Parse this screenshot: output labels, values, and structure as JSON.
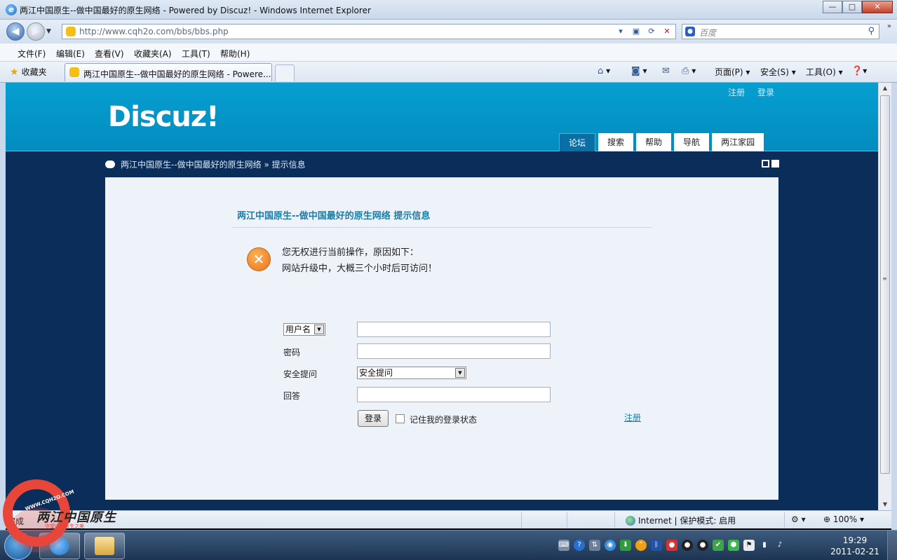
{
  "window": {
    "title": "两江中国原生--做中国最好的原生网络 - Powered by Discuz! - Windows Internet Explorer",
    "controls": {
      "minimize": "—",
      "maximize": "□",
      "close": "✕"
    }
  },
  "address_bar": {
    "url": "http://www.cqh2o.com/bbs/bbs.php",
    "search_placeholder": "百度"
  },
  "menu": [
    "文件(F)",
    "编辑(E)",
    "查看(V)",
    "收藏夹(A)",
    "工具(T)",
    "帮助(H)"
  ],
  "tabs_bar": {
    "favorites": "收藏夹",
    "active_tab": "两江中国原生--做中国最好的原生网络 - Powere...",
    "commands": {
      "page": "页面(P) ▾",
      "safety": "安全(S) ▾",
      "tools": "工具(O) ▾"
    }
  },
  "site": {
    "toplinks": [
      "注册",
      "登录"
    ],
    "logo": "Discuz!",
    "nav": [
      "论坛",
      "搜索",
      "帮助",
      "导航",
      "两江家园"
    ],
    "active_nav": 0,
    "breadcrumb": {
      "home": "两江中国原生--做中国最好的原生网络",
      "sep": "»",
      "current": "提示信息"
    }
  },
  "notice": {
    "heading": "两江中国原生--做中国最好的原生网络  提示信息",
    "line1": "您无权进行当前操作，原因如下：",
    "line2": "网站升级中，大概三个小时后可访问！"
  },
  "login_form": {
    "username_select": "用户名",
    "password_label": "密码",
    "question_label": "安全提问",
    "question_select": "安全提问",
    "answer_label": "回答",
    "submit": "登录",
    "remember": "记住我的登录状态",
    "register": "注册"
  },
  "status_bar": {
    "status": "完成",
    "zone": "Internet | 保护模式: 启用",
    "zoom": "100%"
  },
  "taskbar": {
    "time": "19:29",
    "date": "2011-02-21"
  },
  "watermark": {
    "site": "WWW.CQH2O.COM",
    "name": "两江中国原生",
    "tagline": "守望中国原生之美"
  }
}
